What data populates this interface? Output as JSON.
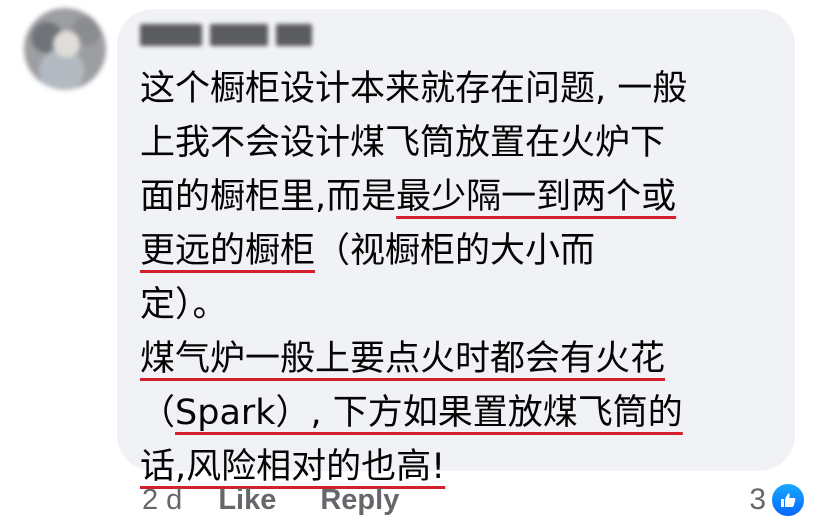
{
  "comment": {
    "author": "",
    "lines": [
      [
        {
          "text": "这个橱柜设计本来就存在问题, 一般",
          "underline": false
        }
      ],
      [
        {
          "text": "上我不会设计煤飞筒放置在火炉下",
          "underline": false
        }
      ],
      [
        {
          "text": "面的橱柜里,而是",
          "underline": false
        },
        {
          "text": "最少隔一到两个或",
          "underline": true
        }
      ],
      [
        {
          "text": "更远的橱柜",
          "underline": true
        },
        {
          "text": "（视橱柜的大小而",
          "underline": false
        }
      ],
      [
        {
          "text": "定）。",
          "underline": false
        }
      ],
      [
        {
          "text": "煤气炉一般上要点火时都会有火花",
          "underline": true
        }
      ],
      [
        {
          "text": "（",
          "underline": false
        },
        {
          "text": "Spark）, 下方如果置放煤飞筒的",
          "underline": true
        }
      ],
      [
        {
          "text": "话,风险相对的也高!",
          "underline": true
        }
      ]
    ]
  },
  "actions": {
    "timestamp": "2 d",
    "like_label": "Like",
    "reply_label": "Reply"
  },
  "reactions": {
    "count": "3",
    "icon": "thumbs-up-icon",
    "badge_color": "#1877f2"
  },
  "colors": {
    "underline": "#d41f2d",
    "bubble": "#f0f2f5",
    "text": "#050505",
    "meta": "#65676b"
  }
}
